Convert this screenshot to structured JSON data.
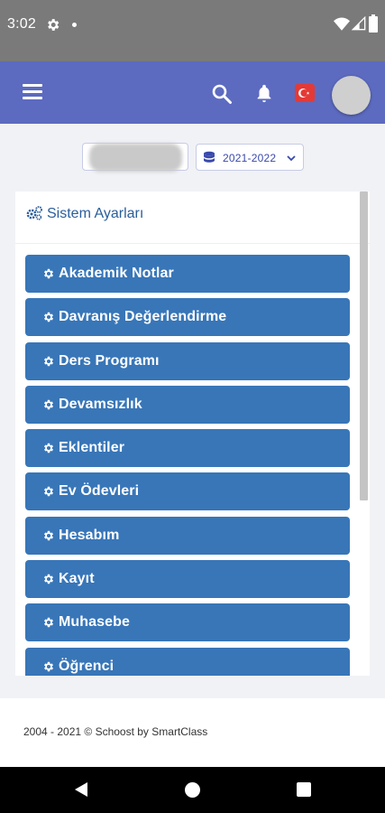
{
  "status_bar": {
    "time": "3:02",
    "icons": [
      "settings-icon",
      "notification-dot",
      "wifi-icon",
      "signal-icon",
      "battery-icon"
    ]
  },
  "navbar": {
    "icons": [
      "hamburger-menu-icon",
      "search-icon",
      "bell-icon",
      "turkish-flag-icon",
      "user-avatar"
    ],
    "color": "#5c6bc0"
  },
  "filters": {
    "school": "",
    "year": "2021-2022"
  },
  "card": {
    "title": "Sistem Ayarları",
    "items": [
      {
        "label": "Akademik Notlar"
      },
      {
        "label": "Davranış Değerlendirme"
      },
      {
        "label": "Ders Programı"
      },
      {
        "label": "Devamsızlık"
      },
      {
        "label": "Eklentiler"
      },
      {
        "label": "Ev Ödevleri"
      },
      {
        "label": "Hesabım"
      },
      {
        "label": "Kayıt"
      },
      {
        "label": "Muhasebe"
      },
      {
        "label": "Öğrenci"
      }
    ],
    "button_color": "#3876b8"
  },
  "footer": {
    "copyright": "2004 - 2021 © Schoost by SmartClass"
  },
  "android_nav": {
    "icons": [
      "back-icon",
      "home-icon",
      "recents-icon"
    ]
  }
}
